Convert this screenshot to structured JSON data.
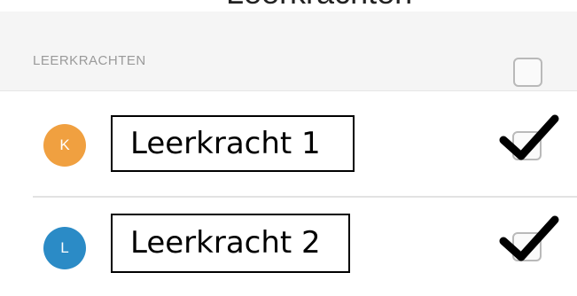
{
  "top_cut_text": "Leerkrachten",
  "section": {
    "title": "LEERKRACHTEN",
    "select_all_checked": false
  },
  "teachers": [
    {
      "initial": "K",
      "name": "Leerkracht 1",
      "avatar_color": "#F0A040",
      "checked": true
    },
    {
      "initial": "L",
      "name": "Leerkracht 2",
      "avatar_color": "#2B8BC6",
      "checked": true
    }
  ],
  "colors": {
    "header_bg": "#F5F5F5",
    "header_text": "#9A9A9A",
    "checkbox_border": "#B9B9B9",
    "check_mark": "#000000"
  },
  "icons": {
    "checkbox": "empty-checkbox-icon",
    "check": "checkmark-icon"
  }
}
